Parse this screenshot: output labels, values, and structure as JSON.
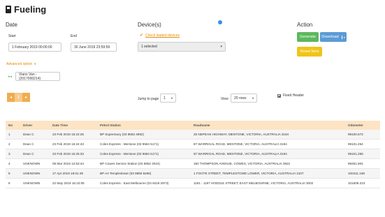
{
  "header": {
    "title": "Fueling"
  },
  "date": {
    "label": "Date",
    "start_label": "Start",
    "start_value": "1 February 2019 00:00:00",
    "end_label": "End",
    "end_value": "30 June 2019 23:59:59"
  },
  "devices": {
    "label": "Device(s)",
    "check_loaded": "Check loaded devices",
    "selected": "1 selected"
  },
  "action": {
    "label": "Action",
    "generate": "Generate",
    "download": "Download",
    "reset": "Reset form"
  },
  "advanced": {
    "label": "Advanced option",
    "vehicle_tag": "Viano Van - (2017000214)"
  },
  "pagination": {
    "page_current": "1",
    "jump_label": "Jump to page",
    "jump_value": "1",
    "view_label": "View",
    "view_value": "20 rows",
    "fixed_header": "Fixed Header"
  },
  "table": {
    "columns": [
      "No",
      "Driver",
      "Date Time",
      "Petrol Station",
      "Roadname",
      "Odometer"
    ],
    "rows": [
      [
        "1",
        "Dean C",
        "23 Feb 2019 15:22:26",
        "BP Supremacy (03 9583 4992)",
        "25 NEPEAN HIGHWAY, MENTONE, VICTORIA, AUSTRALIA 3194",
        "99100.673"
      ],
      [
        "2",
        "Dean C",
        "23 Feb 2019 15:24:43",
        "Coles Express - Mentone (03 9584 5171)",
        "87 WARRIGAL ROAD, MENTONE, VICTORIA, AUSTRALIA 3194",
        "99101.254"
      ],
      [
        "3",
        "Dean C",
        "23 Feb 2019 15:25:33",
        "Coles Express - Mentone (03 9584 5171)",
        "87 WARRIGAL ROAD, MENTONE, VICTORIA, AUSTRALIA 3194",
        "99101.259"
      ],
      [
        "4",
        "UNKNOWN",
        "09 Mar 2019 12:53:44",
        "BP Cowes Service Station (03 5952 2024)",
        "160 THOMPSON AVENUE, COWES, VICTORIA, AUSTRALIA 3922",
        "99451.904"
      ],
      [
        "5",
        "UNKNOWN",
        "17 Apr 2019 18:01:49",
        "BP AA Templestowe (03 9850 8466)",
        "1 FOOTE STREET, TEMPLESTOWE LOWER, VICTORIA, AUSTRALIA 3107",
        "100411.158"
      ],
      [
        "6",
        "UNKNOWN",
        "22 May 2019 16:10:05",
        "Coles Express - East Melbourne (03 9419 2973)",
        "1181 - 1197 HODDLE STREET, EAST MELBOURNE, VICTORIA, AUSTRALIA 3002",
        "101609.223"
      ]
    ]
  },
  "icons": {
    "fuel": "fuel-pump-icon",
    "help": "gear-icon",
    "check": "checkmark-icon",
    "prev": "chevron-left-icon",
    "next": "chevron-right-icon"
  },
  "colors": {
    "generate": "#5cb85c",
    "download": "#5b9bd5",
    "reset": "#f0c419",
    "header_row": "#fce4c4",
    "accent": "#e78a00"
  }
}
